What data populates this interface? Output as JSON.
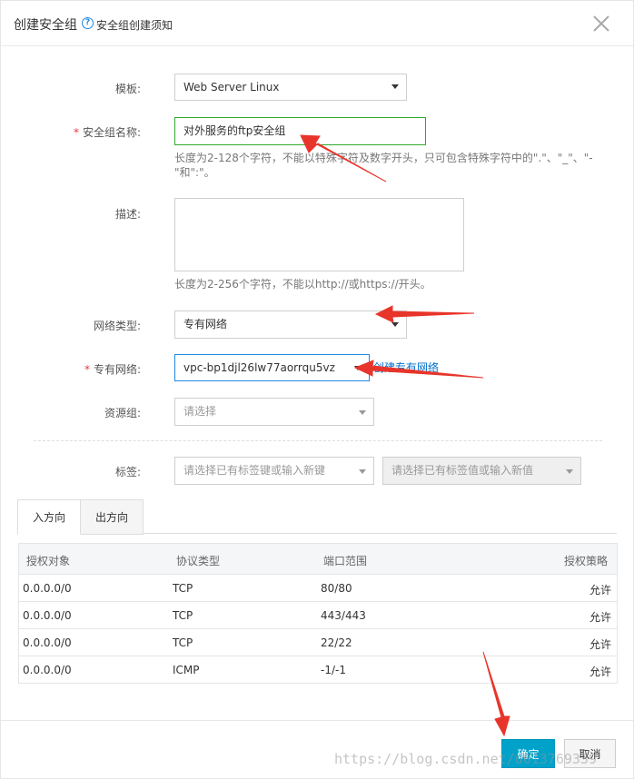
{
  "dialog": {
    "title": "创建安全组",
    "help_link": "安全组创建须知",
    "help_icon": "?"
  },
  "form": {
    "template": {
      "label": "模板:",
      "value": "Web Server Linux"
    },
    "name": {
      "required": "*",
      "label": "安全组名称:",
      "value": "对外服务的ftp安全组",
      "hint": "长度为2-128个字符，不能以特殊字符及数字开头，只可包含特殊字符中的\".\"、\"_\"、\"-\"和\":\"。"
    },
    "description": {
      "label": "描述:",
      "value": "",
      "hint": "长度为2-256个字符，不能以http://或https://开头。"
    },
    "network_type": {
      "label": "网络类型:",
      "value": "专有网络"
    },
    "vpc": {
      "required": "*",
      "label": "专有网络:",
      "value": "vpc-bp1djl26lw77aorrqu5vz",
      "create_link": "创建专有网络"
    },
    "resource_group": {
      "label": "资源组:",
      "placeholder": "请选择"
    },
    "tags": {
      "label": "标签:",
      "key_placeholder": "请选择已有标签键或输入新键",
      "value_placeholder": "请选择已有标签值或输入新值"
    }
  },
  "tabs": [
    {
      "label": "入方向",
      "active": true
    },
    {
      "label": "出方向",
      "active": false
    }
  ],
  "rules_table": {
    "columns": [
      "授权对象",
      "协议类型",
      "端口范围",
      "授权策略"
    ],
    "rows": [
      [
        "0.0.0.0/0",
        "TCP",
        "80/80",
        "允许"
      ],
      [
        "0.0.0.0/0",
        "TCP",
        "443/443",
        "允许"
      ],
      [
        "0.0.0.0/0",
        "TCP",
        "22/22",
        "允许"
      ],
      [
        "0.0.0.0/0",
        "ICMP",
        "-1/-1",
        "允许"
      ]
    ]
  },
  "footer": {
    "confirm_label": "确定",
    "cancel_label": "取消"
  },
  "watermark": "https://blog.csdn.net/u013769339",
  "colors": {
    "primary_button": "#00a2ca",
    "focus_border": "#2eaa2e",
    "active_border": "#1e88e5",
    "link": "#0070cc",
    "required": "#e4393c",
    "annotation_arrow": "#e8352b"
  }
}
